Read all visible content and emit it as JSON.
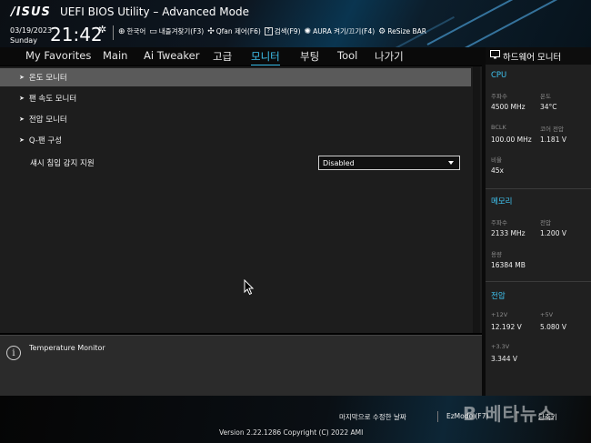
{
  "header": {
    "logo": "/ISUS",
    "title": "UEFI BIOS Utility – Advanced Mode",
    "date": "03/19/2023",
    "day": "Sunday",
    "time": "21:42",
    "tools": [
      {
        "icon": "globe-icon",
        "label": "한국어"
      },
      {
        "icon": "favorites-icon",
        "label": "내즐겨찾기(F3)"
      },
      {
        "icon": "fan-icon",
        "label": "Qfan 제어(F6)"
      },
      {
        "icon": "help-icon",
        "label": "검색(F9)"
      },
      {
        "icon": "aura-icon",
        "label": "AURA 켜기/끄기(F4)"
      },
      {
        "icon": "resize-bar-icon",
        "label": "ReSize BAR"
      }
    ]
  },
  "menu": {
    "items": [
      "My Favorites",
      "Main",
      "Ai Tweaker",
      "고급",
      "모니터",
      "부팅",
      "Tool",
      "나가기"
    ],
    "active": "모니터"
  },
  "main": {
    "rows": [
      "온도 모니터",
      "팬 속도 모니터",
      "전압 모니터",
      "Q-팬 구성"
    ],
    "setting": {
      "label": "섀시 침입 감지 지원",
      "value": "Disabled"
    }
  },
  "help": {
    "text": "Temperature Monitor"
  },
  "hw_monitor": {
    "title": "하드웨어 모니터",
    "cpu": {
      "section": "CPU",
      "freq_label": "주파수",
      "freq": "4500 MHz",
      "temp_label": "온도",
      "temp": "34°C",
      "bclk_label": "BCLK",
      "bclk": "100.00 MHz",
      "core_v_label": "코어 전압",
      "core_v": "1.181 V",
      "ratio_label": "비율",
      "ratio": "45x"
    },
    "memory": {
      "section": "메모리",
      "freq_label": "주파수",
      "freq": "2133 MHz",
      "volt_label": "전압",
      "volt": "1.200 V",
      "cap_label": "용량",
      "cap": "16384 MB"
    },
    "voltage": {
      "section": "전압",
      "v12_label": "+12V",
      "v12": "12.192 V",
      "v5_label": "+5V",
      "v5": "5.080 V",
      "v33_label": "+3.3V",
      "v33": "3.344 V"
    }
  },
  "footer": {
    "last_modified": "마지막으로 수정한 날짜",
    "ezmode": "EzMode (F7)",
    "hotkeys": "단축키",
    "version": "Version 2.22.1286 Copyright (C) 2022 AMI",
    "watermark": "B 베타뉴스"
  }
}
